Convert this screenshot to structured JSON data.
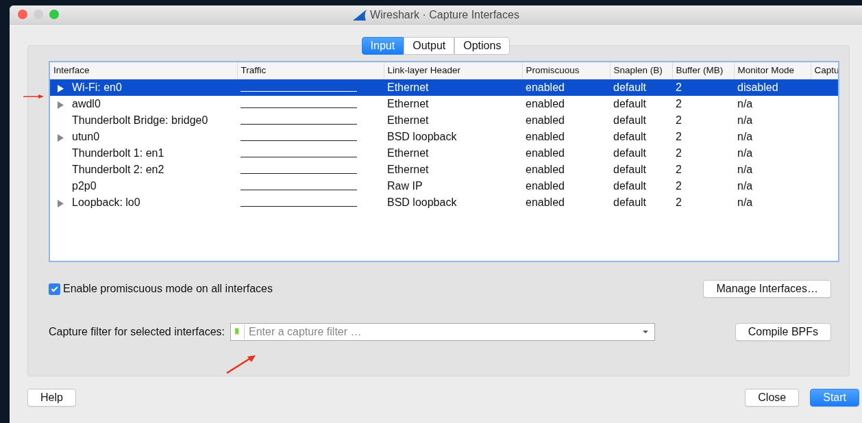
{
  "window": {
    "title": "Wireshark · Capture Interfaces"
  },
  "tabs": [
    {
      "label": "Input",
      "selected": true
    },
    {
      "label": "Output",
      "selected": false
    },
    {
      "label": "Options",
      "selected": false
    }
  ],
  "table": {
    "columns": [
      "Interface",
      "Traffic",
      "Link-layer Header",
      "Promiscuous",
      "Snaplen (B)",
      "Buffer (MB)",
      "Monitor Mode",
      "Captu"
    ],
    "rows": [
      {
        "interface": "Wi-Fi: en0",
        "expandable": true,
        "selected": true,
        "link_layer": "Ethernet",
        "promiscuous": "enabled",
        "snaplen": "default",
        "buffer": "2",
        "monitor_mode": "disabled"
      },
      {
        "interface": "awdl0",
        "expandable": true,
        "selected": false,
        "link_layer": "Ethernet",
        "promiscuous": "enabled",
        "snaplen": "default",
        "buffer": "2",
        "monitor_mode": "n/a"
      },
      {
        "interface": "Thunderbolt Bridge: bridge0",
        "expandable": false,
        "selected": false,
        "link_layer": "Ethernet",
        "promiscuous": "enabled",
        "snaplen": "default",
        "buffer": "2",
        "monitor_mode": "n/a"
      },
      {
        "interface": "utun0",
        "expandable": true,
        "selected": false,
        "link_layer": "BSD loopback",
        "promiscuous": "enabled",
        "snaplen": "default",
        "buffer": "2",
        "monitor_mode": "n/a"
      },
      {
        "interface": "Thunderbolt 1: en1",
        "expandable": false,
        "selected": false,
        "link_layer": "Ethernet",
        "promiscuous": "enabled",
        "snaplen": "default",
        "buffer": "2",
        "monitor_mode": "n/a"
      },
      {
        "interface": "Thunderbolt 2: en2",
        "expandable": false,
        "selected": false,
        "link_layer": "Ethernet",
        "promiscuous": "enabled",
        "snaplen": "default",
        "buffer": "2",
        "monitor_mode": "n/a"
      },
      {
        "interface": "p2p0",
        "expandable": false,
        "selected": false,
        "link_layer": "Raw IP",
        "promiscuous": "enabled",
        "snaplen": "default",
        "buffer": "2",
        "monitor_mode": "n/a"
      },
      {
        "interface": "Loopback: lo0",
        "expandable": true,
        "selected": false,
        "link_layer": "BSD loopback",
        "promiscuous": "enabled",
        "snaplen": "default",
        "buffer": "2",
        "monitor_mode": "n/a"
      }
    ]
  },
  "promiscuous_all": {
    "label": "Enable promiscuous mode on all interfaces",
    "checked": true
  },
  "manage_button": "Manage Interfaces…",
  "capture_filter": {
    "label": "Capture filter for selected interfaces:",
    "placeholder": "Enter a capture filter …"
  },
  "compile_button": "Compile BPFs",
  "buttons": {
    "help": "Help",
    "close": "Close",
    "start": "Start"
  }
}
